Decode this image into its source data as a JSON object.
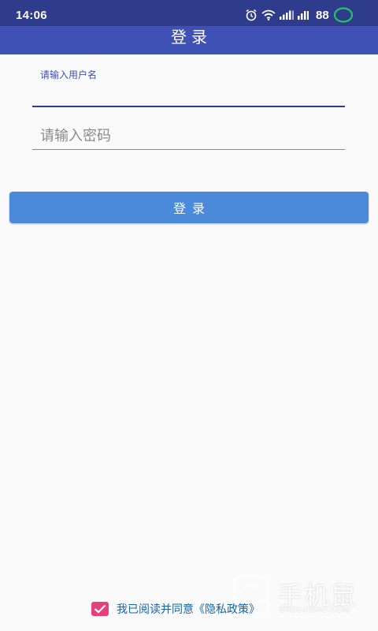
{
  "status_bar": {
    "time": "14:06",
    "battery": "88",
    "icons": [
      "alarm-icon",
      "wifi-icon",
      "signal-icon",
      "hd-signal-icon",
      "battery-ring-icon"
    ],
    "battery_color": "#22c55e"
  },
  "header": {
    "title": "登录"
  },
  "form": {
    "username_label": "请输入用户名",
    "username_value": "",
    "password_placeholder": "请输入密码",
    "password_value": ""
  },
  "login_button": {
    "label": "登录"
  },
  "consent": {
    "checked": true,
    "text": "我已阅读并同意《隐私政策》"
  },
  "watermark": {
    "text": "手机鼠",
    "sub": "SHOUJISHU.COM"
  },
  "colors": {
    "status_bar": "#2f3c8c",
    "header": "#3f51b5",
    "button": "#4a8ad8",
    "checkbox": "#e8407a",
    "link_text": "#1565a8"
  }
}
